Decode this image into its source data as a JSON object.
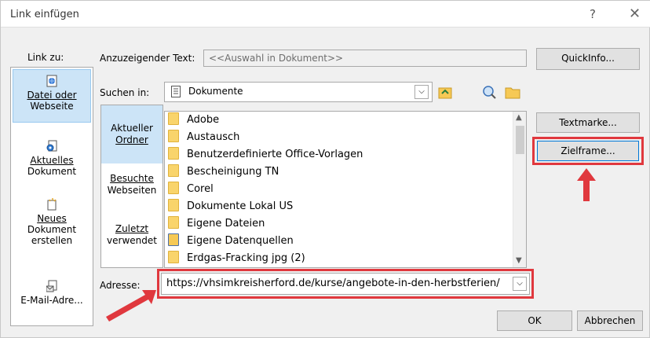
{
  "title": "Link einfügen",
  "titlebar": {
    "help": "?",
    "close": "✕"
  },
  "link_to_label": "Link zu:",
  "link_to_items": [
    {
      "label_line1": "Datei oder",
      "label_line2": "Webseite"
    },
    {
      "label_line1": "Aktuelles",
      "label_line2": "Dokument"
    },
    {
      "label_line1": "Neues",
      "label_line2": "Dokument",
      "label_line3": "erstellen"
    },
    {
      "label_line1": "E-Mail-Adre..."
    }
  ],
  "display_text_label": "Anzuzeigender Text:",
  "display_text_value": "<<Auswahl in Dokument>>",
  "quickinfo_button": "QuickInfo...",
  "look_in_label": "Suchen in:",
  "look_in_value": "Dokumente",
  "tabs": [
    {
      "line1": "Aktueller",
      "line2": "Ordner"
    },
    {
      "line1": "Besuchte",
      "line2": "Webseiten"
    },
    {
      "line1": "Zuletzt",
      "line2": "verwendet"
    }
  ],
  "files": [
    "Adobe",
    "Austausch",
    "Benutzerdefinierte Office-Vorlagen",
    "Bescheinigung TN",
    "Corel",
    "Dokumente Lokal US",
    "Eigene Dateien",
    "Eigene Datenquellen",
    "Erdgas-Fracking jpg (2)"
  ],
  "bookmark_button": "Textmarke...",
  "target_frame_button": "Zielframe...",
  "address_label": "Adresse:",
  "address_value": "https://vhsimkreisherford.de/kurse/angebote-in-den-herbstferien/",
  "ok_button": "OK",
  "cancel_button": "Abbrechen",
  "colors": {
    "highlight": "#e0383e",
    "selection": "#cce4f7",
    "folder": "#f9d46b"
  }
}
